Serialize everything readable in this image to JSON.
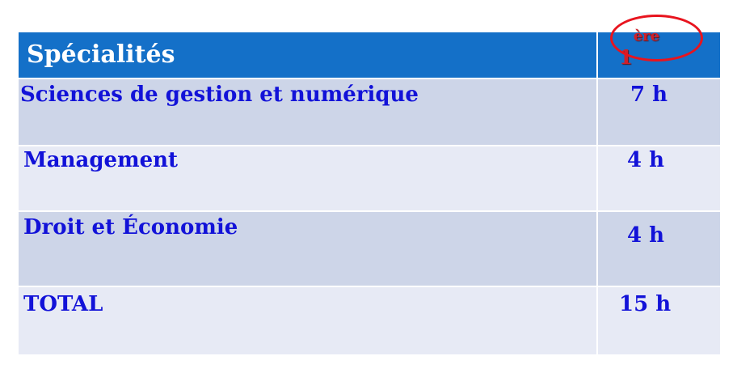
{
  "table": {
    "header": {
      "label": "Spécialités",
      "year_number": "1",
      "year_suffix": "ère"
    },
    "rows": [
      {
        "label": "Sciences de gestion et numérique",
        "hours": "7 h"
      },
      {
        "label": "Management",
        "hours": "4 h"
      },
      {
        "label": "Droit et Économie",
        "hours": "4 h"
      },
      {
        "label": "TOTAL",
        "hours": "15 h"
      }
    ]
  },
  "colors": {
    "header_background": "#1470c8",
    "row_dark": "#cdd5e8",
    "row_light": "#e7eaf5",
    "body_text": "#1212d8",
    "highlight_circle": "#e8141e",
    "year_text": "#d0202a"
  }
}
